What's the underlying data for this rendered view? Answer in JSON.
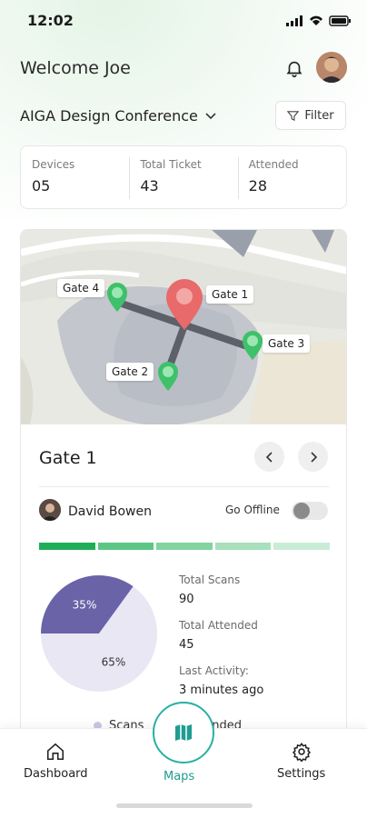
{
  "status_bar": {
    "time": "12:02"
  },
  "header": {
    "welcome": "Welcome Joe"
  },
  "event": {
    "name": "AIGA Design Conference",
    "filter_label": "Filter"
  },
  "stats": [
    {
      "label": "Devices",
      "value": "05"
    },
    {
      "label": "Total Ticket",
      "value": "43"
    },
    {
      "label": "Attended",
      "value": "28"
    }
  ],
  "map": {
    "gates": [
      "Gate 4",
      "Gate 1",
      "Gate 3",
      "Gate 2"
    ],
    "colors": {
      "active_pin": "#e96a6a",
      "gate_pin": "#3fc06a"
    }
  },
  "gate_panel": {
    "title": "Gate 1",
    "person": "David Bowen",
    "offline_label": "Go Offline",
    "offline_enabled": false,
    "progress_colors": [
      "#1fae57",
      "#5cc784",
      "#82d39f",
      "#a7e0bb",
      "#c9ecd6"
    ]
  },
  "metrics": {
    "total_scans_label": "Total Scans",
    "total_scans": "90",
    "total_attended_label": "Total Attended",
    "total_attended": "45",
    "last_activity_label": "Last Activity:",
    "last_activity": "3 minutes ago"
  },
  "chart_data": {
    "type": "pie",
    "slices": [
      {
        "label": "35%",
        "value": 35,
        "color": "#6a63a8"
      },
      {
        "label": "65%",
        "value": 65,
        "color": "#e9e7f3"
      }
    ],
    "legend": [
      "Scans",
      "Attended"
    ]
  },
  "tabs": {
    "dashboard": "Dashboard",
    "maps": "Maps",
    "settings": "Settings"
  },
  "colors": {
    "accent": "#27b0a3",
    "brand_green": "#1fae57"
  }
}
